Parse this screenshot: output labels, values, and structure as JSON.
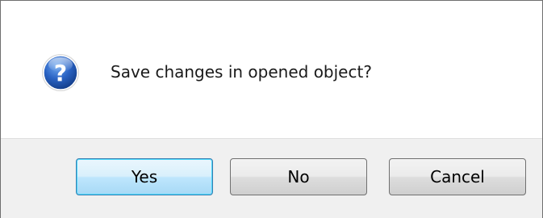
{
  "dialog": {
    "message": "Save changes in opened object?",
    "icon": "question-icon",
    "buttons": {
      "yes": "Yes",
      "no": "No",
      "cancel": "Cancel"
    },
    "colors": {
      "icon_blue": "#1f5fbf",
      "default_button_border": "#3c7fb1",
      "footer_background": "#f0f0f0"
    }
  }
}
